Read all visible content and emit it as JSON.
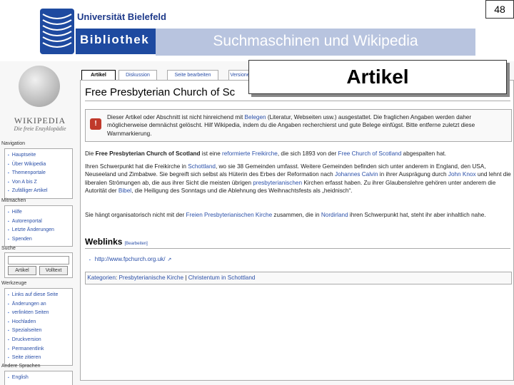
{
  "slide": {
    "university": "Universität Bielefeld",
    "library": "Bibliothek",
    "title": "Suchmaschinen und Wikipedia",
    "page_number": "48",
    "overlay_label": "Artikel"
  },
  "wikipedia": {
    "logo": {
      "wordmark": "WIKIPEDIA",
      "tagline": "Die freie Enzyklopädie"
    },
    "tabs": [
      "Artikel",
      "Diskussion",
      "Seite bearbeiten",
      "Versionen"
    ],
    "sidebar": {
      "navigation": {
        "title": "Navigation",
        "items": [
          "Hauptseite",
          "Über Wikipedia",
          "Themenportale",
          "Von A bis Z",
          "Zufälliger Artikel"
        ]
      },
      "mitmachen": {
        "title": "Mitmachen",
        "items": [
          "Hilfe",
          "Autorenportal",
          "Letzte Änderungen",
          "Spenden"
        ]
      },
      "search": {
        "title": "Suche",
        "buttons": [
          "Artikel",
          "Volltext"
        ]
      },
      "werkzeuge": {
        "title": "Werkzeuge",
        "items": [
          "Links auf diese Seite",
          "Änderungen an",
          "verlinkten Seiten",
          "Hochladen",
          "Spezialseiten",
          "Druckversion",
          "Permanentlink",
          "Seite zitieren"
        ]
      },
      "languages": {
        "title": "Andere Sprachen",
        "items": [
          "English"
        ]
      }
    },
    "article": {
      "title": "Free Presbyterian Church of Sc",
      "notice": {
        "icon": "warning-icon",
        "text_1": "Dieser Artikel oder Abschnitt ist nicht hinreichend mit ",
        "link": "Belegen",
        "text_2": " (Literatur, Webseiten usw.) ausgestattet. Die fraglichen Angaben werden daher möglicherweise demnächst gelöscht. Hilf Wikipedia, indem du die Angaben recherchierst und gute Belege einfügst. Bitte entferne zuletzt diese Warnmarkierung."
      },
      "p1": {
        "t1": "Die ",
        "bold": "Free Presbyterian Church of Scotland",
        "t2": " ist eine ",
        "l1": "reformierte Freikirche",
        "t3": ", die sich 1893 von der ",
        "l2": "Free Church of Scotland",
        "t4": " abgespalten hat."
      },
      "p2": {
        "t1": "Ihren Schwerpunkt hat die Freikirche in ",
        "l1": "Schottland",
        "t2": ", wo sie 38 Gemeinden umfasst. Weitere Gemeinden befinden sich unter anderem in England, den USA, Neuseeland und Zimbabwe. Sie begreift sich selbst als Hüterin des Erbes der Reformation nach ",
        "l2": "Johannes Calvin",
        "t3": " in ihrer Ausprägung durch ",
        "l3": "John Knox",
        "t4": " und lehnt die liberalen Strömungen ab, die aus ihrer Sicht die meisten übrigen ",
        "l4": "presbyterianischen",
        "t5": " Kirchen erfasst haben. Zu ihrer Glaubenslehre gehören unter anderem die Autorität der ",
        "l5": "Bibel",
        "t6": ", die Heiligung des Sonntags und die Ablehnung des Weihnachtsfests als „heidnisch“."
      },
      "p3": {
        "t1": "Sie hängt organisatorisch nicht mit der ",
        "l1": "Freien Presbyterianischen Kirche",
        "t2": " zusammen, die in ",
        "l2": "Nordirland",
        "t3": " ihren Schwerpunkt hat, steht ihr aber inhaltlich nahe."
      },
      "weblinks": {
        "heading": "Weblinks",
        "edit": "[Bearbeiten]",
        "items": [
          "http://www.fpchurch.org.uk/"
        ]
      },
      "categories": {
        "label": "Kategorien",
        "items": [
          "Presbyterianische Kirche",
          "Christentum in Schottland"
        ]
      }
    }
  },
  "colors": {
    "brand_blue": "#1e4aa0",
    "title_bar": "#b8c4df",
    "link": "#2a4fa8"
  }
}
